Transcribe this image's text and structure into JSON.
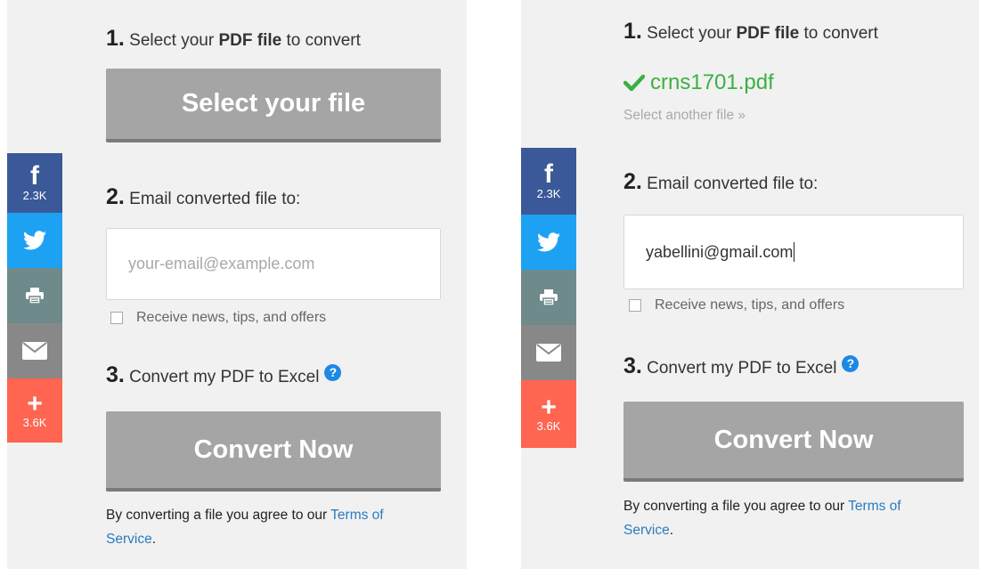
{
  "social": {
    "facebook_count": "2.3K",
    "share_count": "3.6K",
    "icons": [
      "facebook-icon",
      "twitter-icon",
      "print-icon",
      "email-icon",
      "plus-icon"
    ]
  },
  "left": {
    "step1_num": "1.",
    "step1_pre": "Select your ",
    "step1_bold": "PDF file",
    "step1_post": " to convert",
    "select_file_label": "Select your file",
    "step2_num": "2.",
    "step2_text": "Email converted file to:",
    "email_placeholder": "your-email@example.com",
    "checkbox_label": "Receive news, tips, and offers",
    "step3_num": "3.",
    "step3_text": "Convert my PDF to Excel",
    "help_glyph": "?",
    "convert_label": "Convert Now",
    "terms_text": "By converting a file you agree to our ",
    "terms_link_1": "Terms of",
    "terms_link_2": "Service",
    "terms_end": "."
  },
  "right": {
    "step1_num": "1.",
    "step1_pre": "Select your ",
    "step1_bold": "PDF file",
    "step1_post": " to convert",
    "file_name": "crns1701.pdf",
    "select_another": "Select another file »",
    "step2_num": "2.",
    "step2_text": "Email converted file to:",
    "email_value": "yabellini@gmail.com",
    "checkbox_label": "Receive news, tips, and offers",
    "step3_num": "3.",
    "step3_text": "Convert my PDF to Excel",
    "help_glyph": "?",
    "convert_label": "Convert Now",
    "terms_text": "By converting a file you agree to our ",
    "terms_link_1": "Terms of",
    "terms_link_2": "Service",
    "terms_end": "."
  },
  "colors": {
    "facebook": "#3b5998",
    "twitter": "#1da1f2",
    "print": "#6e8a8a",
    "email": "#888888",
    "share": "#ff6550",
    "button_gray": "#a5a5a5",
    "link": "#2b7bc0",
    "success_green": "#3cb043",
    "help_blue": "#1e88e5"
  }
}
